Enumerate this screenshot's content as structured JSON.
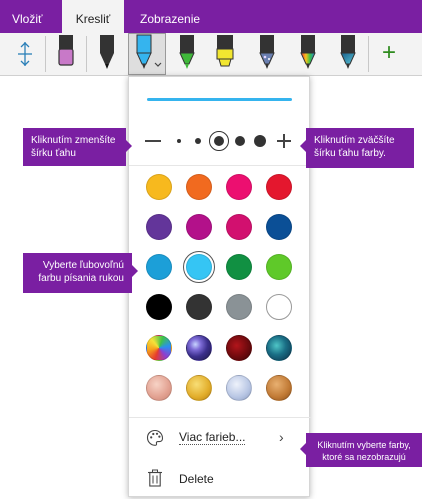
{
  "tabs": {
    "vlozit": "Vložiť",
    "kreslit": "Kresliť",
    "zobrazenie": "Zobrazenie"
  },
  "toolbar": {
    "tools": [
      {
        "icon": "lasso-space-icon"
      },
      {
        "icon": "eraser-icon",
        "color": "#c879c8"
      },
      {
        "icon": "pen-black-icon",
        "color": "#222222"
      },
      {
        "icon": "pen-blue-selected-icon",
        "color": "#35b4ee"
      },
      {
        "icon": "pen-green-icon",
        "color": "#3fb83a"
      },
      {
        "icon": "highlighter-yellow-icon",
        "color": "#f2e630"
      },
      {
        "icon": "pen-galaxy-icon",
        "color": "#6a7fb0"
      },
      {
        "icon": "pen-rainbow-icon",
        "color": "#e06a2a"
      },
      {
        "icon": "pen-ocean-icon",
        "color": "#2f8fb3"
      },
      {
        "icon": "add-pen-icon",
        "color": "#2e8b1e"
      }
    ],
    "add_symbol": "+"
  },
  "flyout": {
    "current_color": "#35b4ee",
    "width_controls": {
      "minus": "−",
      "plus": "+",
      "selected_index": 2
    },
    "swatches": [
      [
        "#f7b91e",
        "#f16a1f",
        "#ec0f70",
        "#e4172e"
      ],
      [
        "#63359a",
        "#b3118a",
        "#d2106f",
        "#0b4f96"
      ],
      [
        "#1c9fd8",
        "#35c5f4",
        "#119042",
        "#5fc929"
      ],
      [
        "#000000",
        "#333333",
        "#8a9296",
        "#ffffff"
      ],
      [
        "rainbow",
        "galaxy",
        "lava",
        "ocean"
      ],
      [
        "rose-gold",
        "gold",
        "silver",
        "bronze"
      ]
    ],
    "selected_swatch": [
      2,
      1
    ],
    "more_colors": "Viac farieb...",
    "delete": "Delete"
  },
  "callouts": {
    "decrease": "Kliknutím zmenšíte šírku ťahu",
    "increase": "Kliknutím zväčšíte šírku ťahu farby.",
    "pick_color": "Vyberte ľubovoľnú farbu písania rukou",
    "more_colors": "Kliknutím vyberte farby, ktoré sa nezobrazujú"
  }
}
